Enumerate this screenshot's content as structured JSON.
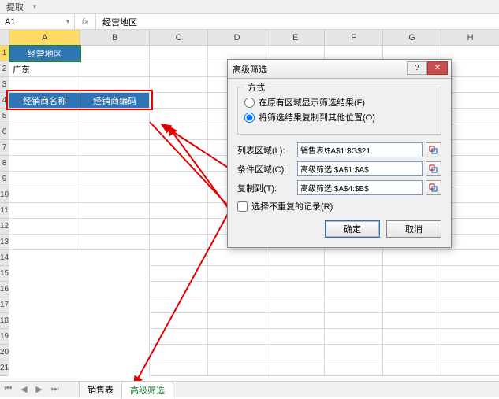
{
  "ribbon": {
    "label": "提取"
  },
  "namebox": {
    "value": "A1"
  },
  "formula": {
    "value": "经营地区"
  },
  "cells": {
    "a1": "经营地区",
    "a2": "广东",
    "a4": "经销商名称",
    "b4": "经销商编码"
  },
  "cols": [
    "A",
    "B",
    "C",
    "D",
    "E",
    "F",
    "G",
    "H"
  ],
  "rows": [
    "1",
    "2",
    "3",
    "4",
    "5",
    "6",
    "7",
    "8",
    "9",
    "10",
    "11",
    "12",
    "13",
    "14",
    "15",
    "16",
    "17",
    "18",
    "19",
    "20",
    "21"
  ],
  "tabs": {
    "tab1": "销售表",
    "tab2": "高级筛选"
  },
  "dialog": {
    "title": "高级筛选",
    "group_label": "方式",
    "radio1": "在原有区域显示筛选结果(F)",
    "radio2": "将筛选结果复制到其他位置(O)",
    "list_label": "列表区域(L):",
    "list_value": "销售表!$A$1:$G$21",
    "crit_label": "条件区域(C):",
    "crit_value": "高级筛选!$A$1:$A$",
    "copy_label": "复制到(T):",
    "copy_value": "高级筛选!$A$4:$B$",
    "unique": "选择不重复的记录(R)",
    "ok": "确定",
    "cancel": "取消"
  }
}
